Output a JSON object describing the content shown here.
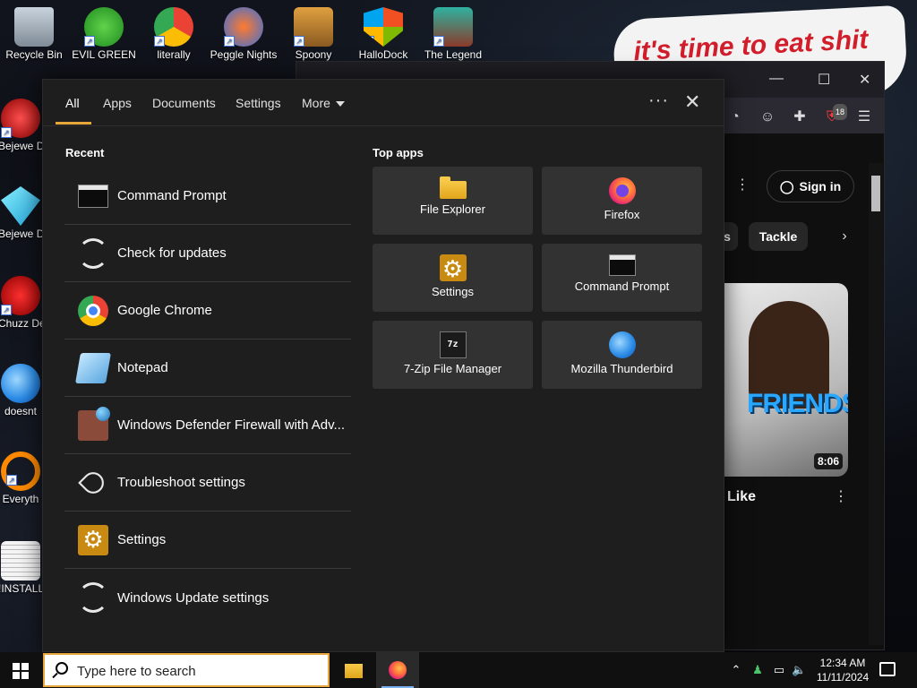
{
  "desktop": {
    "icons": [
      {
        "label": "Recycle Bin",
        "name": "recycle-bin"
      },
      {
        "label": "EVIL GREEN",
        "name": "evil-green"
      },
      {
        "label": "literally",
        "name": "literally"
      },
      {
        "label": "Peggle Nights",
        "name": "peggle-nights"
      },
      {
        "label": "Spoony",
        "name": "spoony"
      },
      {
        "label": "HalloDock",
        "name": "hallodock"
      },
      {
        "label": "The Legend",
        "name": "the-legend"
      },
      {
        "label": "Bejewe Delux",
        "name": "bejeweled-1"
      },
      {
        "label": "Bejewe Delux",
        "name": "bejeweled-2"
      },
      {
        "label": "Chuzz Delux",
        "name": "chuzzle"
      },
      {
        "label": "doesnt",
        "name": "doesnt"
      },
      {
        "label": "Everyth",
        "name": "everything"
      },
      {
        "label": "!INSTALL",
        "name": "install"
      }
    ],
    "sticker_text": "it's time to eat shit"
  },
  "browser": {
    "signin_label": "Sign in",
    "chip_partial": "s",
    "chip_tackle": "Tackle",
    "extension_badge": "18",
    "video_title": "Like",
    "video_duration": "8:06",
    "thumbnail_text": "FRIENDS"
  },
  "search_panel": {
    "tabs": [
      {
        "label": "All",
        "active": true
      },
      {
        "label": "Apps"
      },
      {
        "label": "Documents"
      },
      {
        "label": "Settings"
      },
      {
        "label": "More"
      }
    ],
    "recent_title": "Recent",
    "recent": [
      {
        "label": "Command Prompt",
        "icon": "command-prompt-icon"
      },
      {
        "label": "Check for updates",
        "icon": "sync-icon"
      },
      {
        "label": "Google Chrome",
        "icon": "chrome-icon"
      },
      {
        "label": "Notepad",
        "icon": "notepad-icon"
      },
      {
        "label": "Windows Defender Firewall with Adv...",
        "icon": "firewall-icon"
      },
      {
        "label": "Troubleshoot settings",
        "icon": "wrench-icon"
      },
      {
        "label": "Settings",
        "icon": "settings-gear-icon"
      },
      {
        "label": "Windows Update settings",
        "icon": "sync-icon"
      }
    ],
    "top_apps_title": "Top apps",
    "top_apps": [
      {
        "label": "File Explorer",
        "icon": "folder-icon"
      },
      {
        "label": "Firefox",
        "icon": "firefox-icon"
      },
      {
        "label": "Settings",
        "icon": "settings-gear-icon"
      },
      {
        "label": "Command Prompt",
        "icon": "command-prompt-icon"
      },
      {
        "label": "7-Zip File Manager",
        "icon": "7zip-icon"
      },
      {
        "label": "Mozilla Thunderbird",
        "icon": "thunderbird-icon"
      }
    ]
  },
  "taskbar": {
    "search_value": "Type here to search",
    "time": "12:34 AM",
    "date": "11/11/2024"
  },
  "colors": {
    "accent": "#e7a53a",
    "panel_bg": "#1e1e1e",
    "tile_bg": "#323232"
  }
}
